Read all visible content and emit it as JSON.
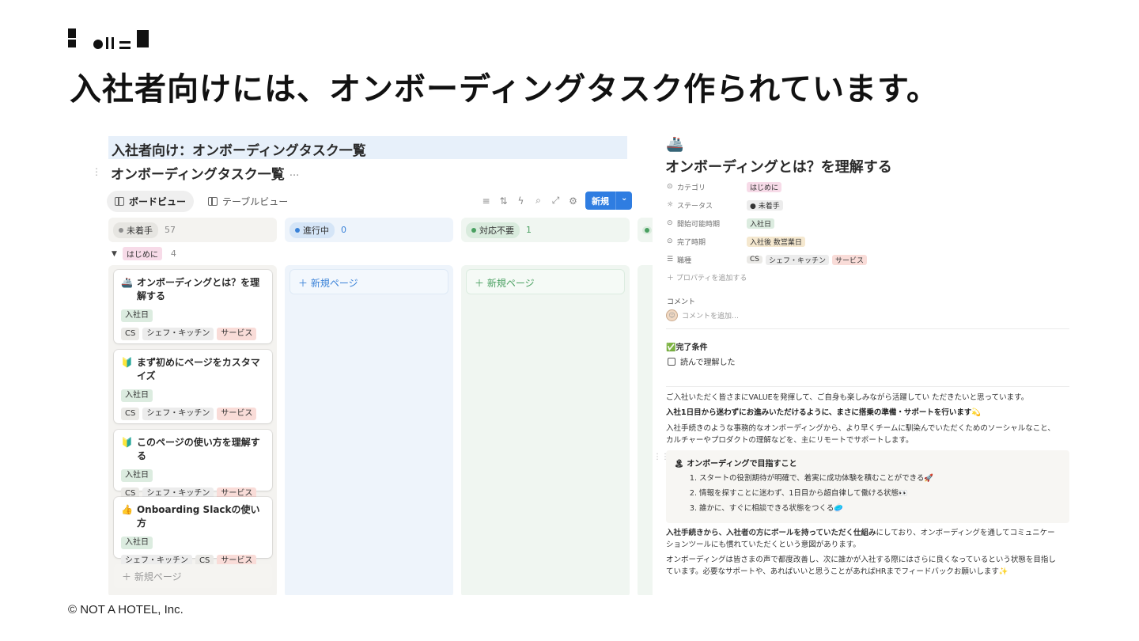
{
  "slide": {
    "title": "入社者向けには、オンボーディングタスク作られています。",
    "footer": "© NOT A HOTEL, Inc."
  },
  "board": {
    "heading": "入社者向け：オンボーディングタスク一覧",
    "db_title": "オンボーディングタスク一覧",
    "db_more": "···",
    "views": [
      {
        "label": "ボードビュー",
        "active": true
      },
      {
        "label": "テーブルビュー",
        "active": false
      }
    ],
    "toolbar": {
      "new_label": "新規",
      "new_dropdown": "⌄"
    },
    "columns": [
      {
        "label": "未着手",
        "count": "57",
        "bg": "#f4f3f0",
        "pill_bg": "#e6e5e1",
        "dot": "#8f8f8f"
      },
      {
        "label": "進行中",
        "count": "0",
        "bg": "#eef4fb",
        "pill_bg": "#d5e5f7",
        "dot": "#3a82d8"
      },
      {
        "label": "対応不要",
        "count": "1",
        "bg": "#f0f6f1",
        "pill_bg": "#d9ebdd",
        "dot": "#4aa061"
      }
    ],
    "group": {
      "label": "はじめに",
      "count": "4"
    },
    "cards": [
      {
        "emoji": "🚢",
        "title": "オンボーディングとは？を理解する",
        "date": "入社日",
        "tags": [
          "CS",
          "シェフ・キッチン",
          "サービス"
        ]
      },
      {
        "emoji": "🔰",
        "title": "まず初めにページをカスタマイズ",
        "date": "入社日",
        "tags": [
          "CS",
          "シェフ・キッチン",
          "サービス"
        ]
      },
      {
        "emoji": "🔰",
        "title": "このページの使い方を理解する",
        "date": "入社日",
        "tags": [
          "CS",
          "シェフ・キッチン",
          "サービス"
        ]
      },
      {
        "emoji": "👍",
        "title": "Onboarding Slackの使い方",
        "date": "入社日",
        "tags": [
          "シェフ・キッチン",
          "CS",
          "サービス"
        ]
      }
    ],
    "add_card": "＋ 新規ページ",
    "new_page": "＋ 新規ページ"
  },
  "page": {
    "icon": "🚢",
    "title": "オンボーディングとは？を理解する",
    "properties": [
      {
        "name": "カテゴリ",
        "icon": "⊙",
        "values": [
          {
            "text": "はじめに",
            "color": "pink"
          }
        ]
      },
      {
        "name": "ステータス",
        "icon": "☼",
        "values": [
          {
            "text": "● 未着手",
            "color": "soft"
          }
        ]
      },
      {
        "name": "開始可能時期",
        "icon": "⊙",
        "values": [
          {
            "text": "入社日",
            "color": "green"
          }
        ]
      },
      {
        "name": "完了時期",
        "icon": "⊙",
        "values": [
          {
            "text": "入社後 数営業日",
            "color": "beige"
          }
        ]
      },
      {
        "name": "職種",
        "icon": "☰",
        "values": [
          {
            "text": "CS",
            "color": "gray"
          },
          {
            "text": "シェフ・キッチン",
            "color": "soft"
          },
          {
            "text": "サービス",
            "color": "red"
          }
        ]
      }
    ],
    "add_property": "＋ プロパティを追加する",
    "comment_label": "コメント",
    "comment_placeholder": "コメントを追加…",
    "done_title": "✅完了条件",
    "checkbox_label": "読んで理解した",
    "p1": "ご入社いただく皆さまにVALUEを発揮して、ご自身も楽しみながら活躍してい ただきたいと思っています。",
    "p2": "入社1日目から迷わずにお進みいただけるように、まさに搭乗の準備・サポートを行います💫",
    "p3a": "入社手続きのような事務的なオンボーディングから、より早くチームに馴染んでいただくためのソーシャルなこと、",
    "p3b": "カルチャーやプロダクトの理解などを、主にリモートでサポートします。",
    "callout": {
      "icon": "🏝",
      "title": "オンボーディングで目指すこと",
      "items": [
        "スタートの役割期待が明確で、着実に成功体験を積むことができる🚀",
        "情報を探すことに迷わず、1日目から超自律して働ける状態👀",
        "誰かに、すぐに相談できる状態をつくる🥏"
      ]
    },
    "p4a": "入社手続きから、入社者の方にボールを持っていただく仕組み",
    "p4b": "にしており、オンボーディングを通してコミュニケー",
    "p4c": "ションツールにも慣れていただくという意図があります。",
    "p5a": "オンボーディングは皆さまの声で都度改善し、次に誰かが入社する際にはさらに良くなっているという状態を目指し",
    "p5b": "ています。必要なサポートや、あればいいと思うことがあればHRまでフィードバックお願いします✨"
  }
}
